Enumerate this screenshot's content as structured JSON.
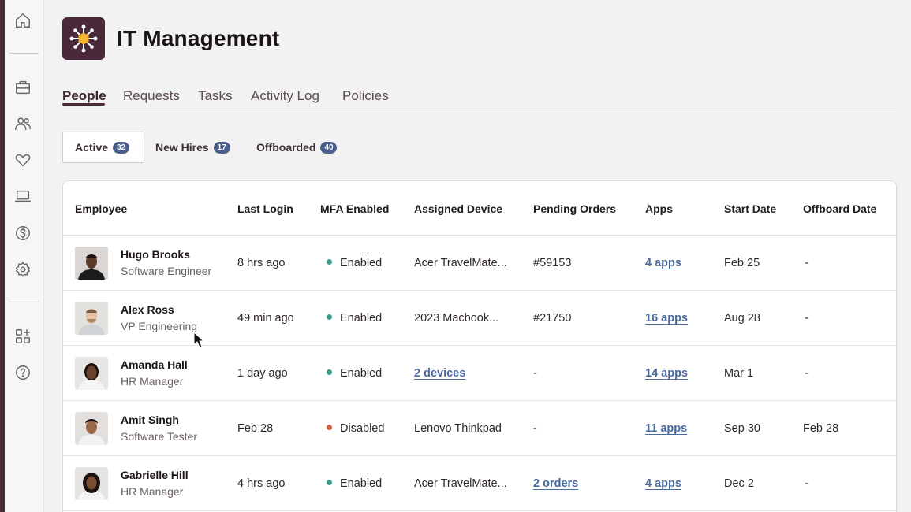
{
  "app": {
    "title": "IT Management"
  },
  "sidebar": {
    "icons": [
      "home-icon",
      "briefcase-icon",
      "people-icon",
      "heart-icon",
      "laptop-icon",
      "dollar-icon",
      "gear-icon",
      "apps-add-icon",
      "help-icon"
    ]
  },
  "tabs": [
    "People",
    "Requests",
    "Tasks",
    "Activity Log",
    "Policies"
  ],
  "active_tab": "People",
  "subtabs": [
    {
      "label": "Active",
      "count": "32"
    },
    {
      "label": "New Hires",
      "count": "17"
    },
    {
      "label": "Offboarded",
      "count": "40"
    }
  ],
  "table": {
    "headers": [
      "Employee",
      "Last Login",
      "MFA Enabled",
      "Assigned Device",
      "Pending Orders",
      "Apps",
      "Start Date",
      "Offboard Date"
    ],
    "rows": [
      {
        "name": "Hugo Brooks",
        "role": "Software Engineer",
        "last_login": "8 hrs ago",
        "mfa": "Enabled",
        "device": "Acer TravelMate...",
        "orders": "#59153",
        "apps": "4 apps",
        "start": "Feb 25",
        "offboard": "-"
      },
      {
        "name": "Alex Ross",
        "role": "VP Engineering",
        "last_login": "49 min ago",
        "mfa": "Enabled",
        "device": "2023 Macbook...",
        "orders": "#21750",
        "apps": "16 apps",
        "start": "Aug 28",
        "offboard": "-"
      },
      {
        "name": "Amanda Hall",
        "role": "HR Manager",
        "last_login": "1 day ago",
        "mfa": "Enabled",
        "device": "2 devices",
        "orders": "-",
        "apps": "14 apps",
        "start": "Mar 1",
        "offboard": "-"
      },
      {
        "name": "Amit Singh",
        "role": "Software Tester",
        "last_login": "Feb 28",
        "mfa": "Disabled",
        "device": "Lenovo Thinkpad",
        "orders": "-",
        "apps": "11 apps",
        "start": "Sep 30",
        "offboard": "Feb 28"
      },
      {
        "name": "Gabrielle Hill",
        "role": "HR Manager",
        "last_login": "4 hrs ago",
        "mfa": "Enabled",
        "device": "Acer TravelMate...",
        "orders": "2 orders",
        "apps": "4 apps",
        "start": "Dec 2",
        "offboard": "-"
      }
    ]
  },
  "colors": {
    "brand": "#4a2a3a",
    "enabled": "#3f9a8c",
    "disabled": "#d0604a",
    "link": "#4a6a9f",
    "badge": "#4a5e8c"
  }
}
